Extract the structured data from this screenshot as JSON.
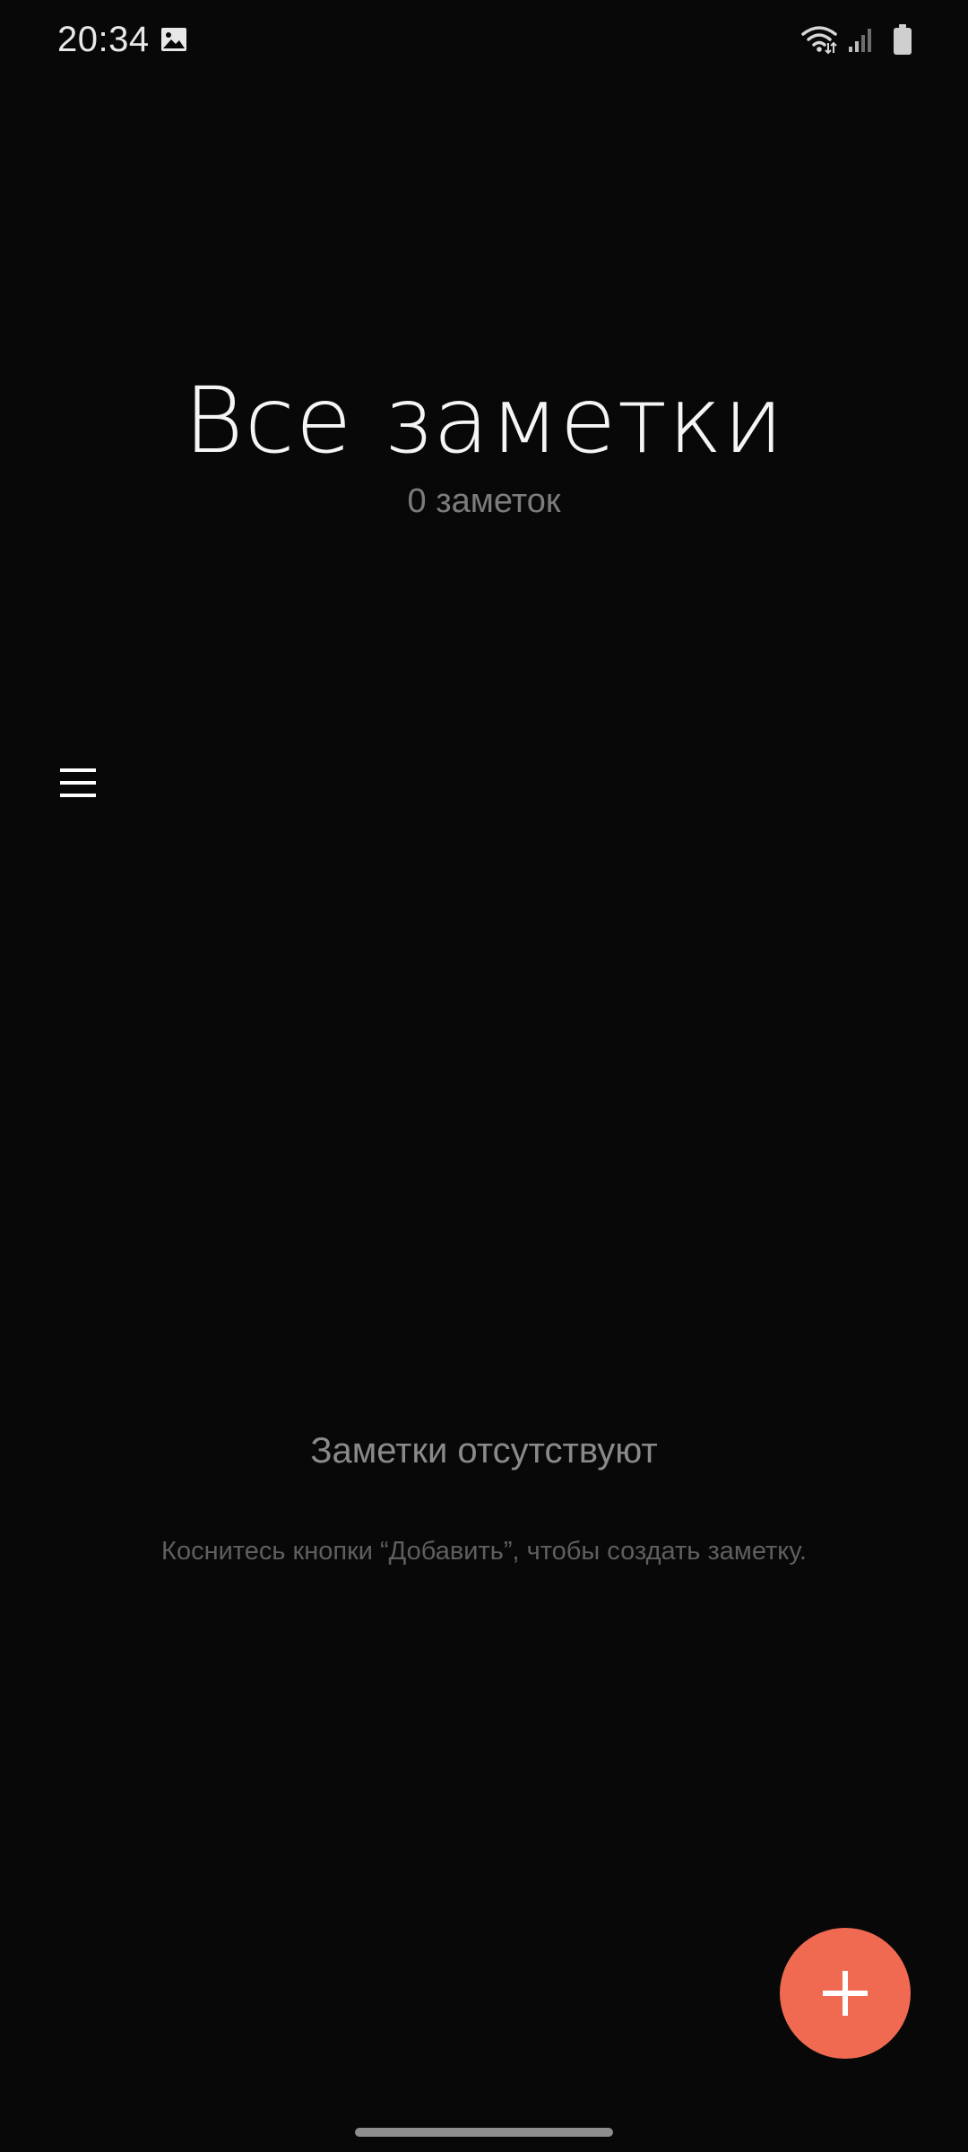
{
  "status_bar": {
    "time": "20:34",
    "icons": [
      "gallery-icon",
      "wifi-icon",
      "signal-icon",
      "battery-icon"
    ]
  },
  "header": {
    "title": "Все заметки",
    "subtitle": "0 заметок"
  },
  "menu": {
    "icon": "hamburger-menu-icon"
  },
  "empty_state": {
    "title": "Заметки отсутствуют",
    "hint": "Коснитесь кнопки “Добавить”, чтобы создать заметку."
  },
  "fab": {
    "icon": "plus-icon",
    "color": "#f06a52"
  },
  "colors": {
    "background": "#080808",
    "accent": "#f06a52"
  }
}
